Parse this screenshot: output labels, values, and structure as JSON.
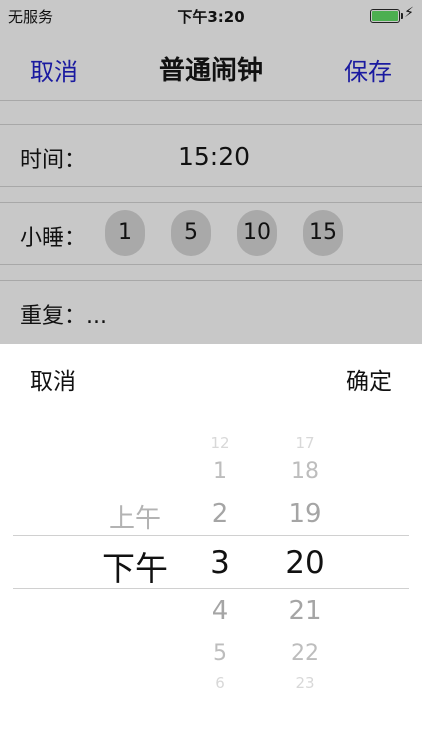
{
  "status_bar": {
    "carrier": "无服务",
    "time": "下午3:20",
    "battery_level": 1.0,
    "battery_color": "#4caf50",
    "charging_icon": "bolt-icon"
  },
  "nav": {
    "cancel_label": "取消",
    "title": "普通闹钟",
    "save_label": "保存",
    "link_color": "#1a1aa0"
  },
  "form": {
    "time_label": "时间：",
    "time_value": "15:20",
    "snooze_label": "小睡：",
    "snooze_options": [
      "1",
      "5",
      "10",
      "15"
    ],
    "repeat_label": "重复：..."
  },
  "picker": {
    "cancel_label": "取消",
    "confirm_label": "确定",
    "ampm": {
      "above": "上午",
      "selected": "下午"
    },
    "hours": {
      "above": [
        "12",
        "1",
        "2"
      ],
      "selected": "3",
      "below": [
        "4",
        "5",
        "6"
      ]
    },
    "minutes": {
      "above": [
        "17",
        "18",
        "19"
      ],
      "selected": "20",
      "below": [
        "21",
        "22",
        "23"
      ]
    }
  }
}
